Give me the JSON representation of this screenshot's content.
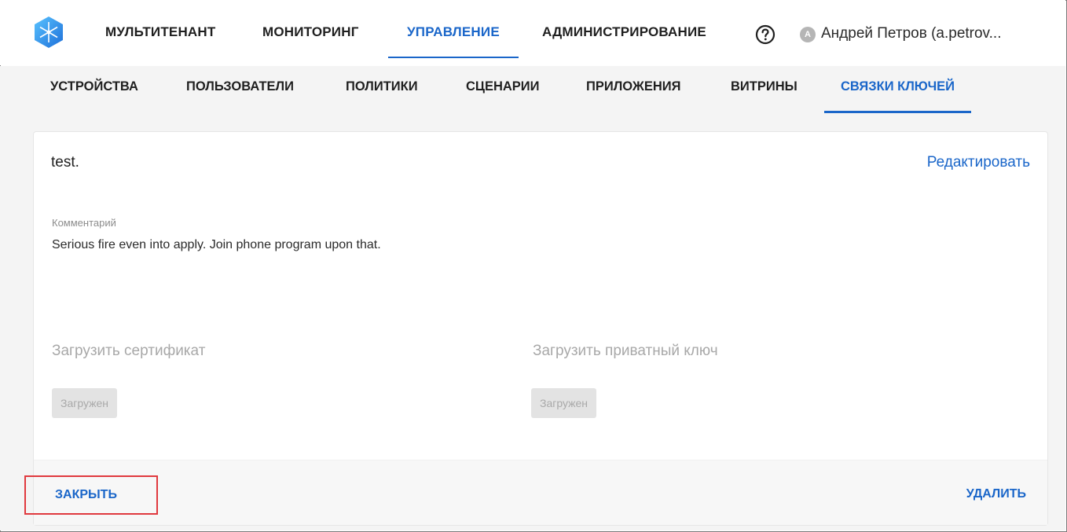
{
  "header": {
    "nav": [
      {
        "label": "МУЛЬТИТЕНАНТ"
      },
      {
        "label": "МОНИТОРИНГ"
      },
      {
        "label": "УПРАВЛЕНИЕ"
      },
      {
        "label": "АДМИНИСТРИРОВАНИЕ"
      }
    ],
    "active_nav": "УПРАВЛЕНИЕ",
    "help_icon": "question-circle-icon",
    "avatar_letter": "A",
    "user": "Андрей Петров (a.petrov..."
  },
  "subnav": {
    "items": [
      {
        "label": "УСТРОЙСТВА"
      },
      {
        "label": "ПОЛЬЗОВАТЕЛИ"
      },
      {
        "label": "ПОЛИТИКИ"
      },
      {
        "label": "СЦЕНАРИИ"
      },
      {
        "label": "ПРИЛОЖЕНИЯ"
      },
      {
        "label": "ВИТРИНЫ"
      },
      {
        "label": "СВЯЗКИ КЛЮЧЕЙ"
      }
    ],
    "active": "СВЯЗКИ КЛЮЧЕЙ"
  },
  "card": {
    "title": "test.",
    "edit_label": "Редактировать",
    "comment_label": "Комментарий",
    "comment_text": "Serious fire even into apply. Join phone program upon that.",
    "certificate": {
      "title": "Загрузить сертификат",
      "status": "Загружен"
    },
    "private_key": {
      "title": "Загрузить приватный ключ",
      "status": "Загружен"
    },
    "close_label": "ЗАКРЫТЬ",
    "delete_label": "УДАЛИТЬ"
  },
  "colors": {
    "accent": "#1a66c9",
    "highlight_border": "#e0393e",
    "background": "#f4f4f4"
  }
}
